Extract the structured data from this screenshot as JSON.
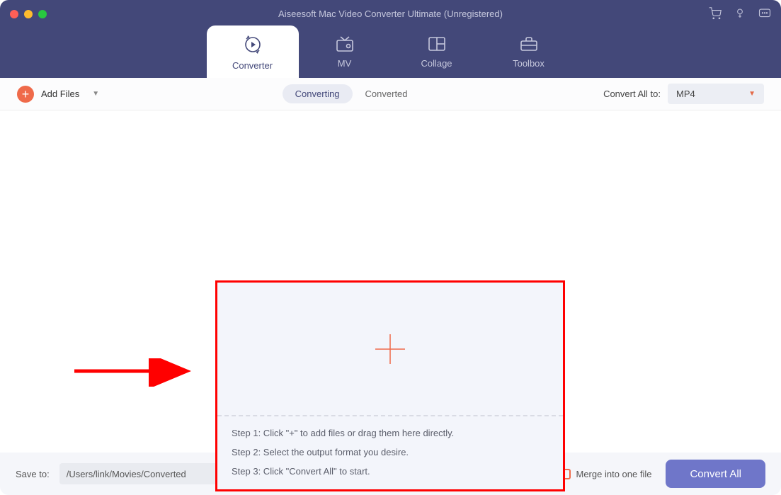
{
  "header": {
    "app_title": "Aiseesoft Mac Video Converter Ultimate (Unregistered)",
    "tabs": [
      {
        "label": "Converter"
      },
      {
        "label": "MV"
      },
      {
        "label": "Collage"
      },
      {
        "label": "Toolbox"
      }
    ]
  },
  "toolbar": {
    "add_files_label": "Add Files",
    "segments": {
      "converting": "Converting",
      "converted": "Converted"
    },
    "convert_all_to_label": "Convert All to:",
    "format_selected": "MP4"
  },
  "dropzone": {
    "step1": "Step 1: Click \"+\" to add files or drag them here directly.",
    "step2": "Step 2: Select the output format you desire.",
    "step3": "Step 3: Click \"Convert All\" to start."
  },
  "footer": {
    "save_to_label": "Save to:",
    "save_path": "/Users/link/Movies/Converted",
    "merge_label": "Merge into one file",
    "convert_all_btn": "Convert All"
  },
  "colors": {
    "header_bg": "#434879",
    "accent_orange": "#ef6a4a",
    "accent_purple": "#6f76c9",
    "annotation_red": "#ff0000"
  }
}
